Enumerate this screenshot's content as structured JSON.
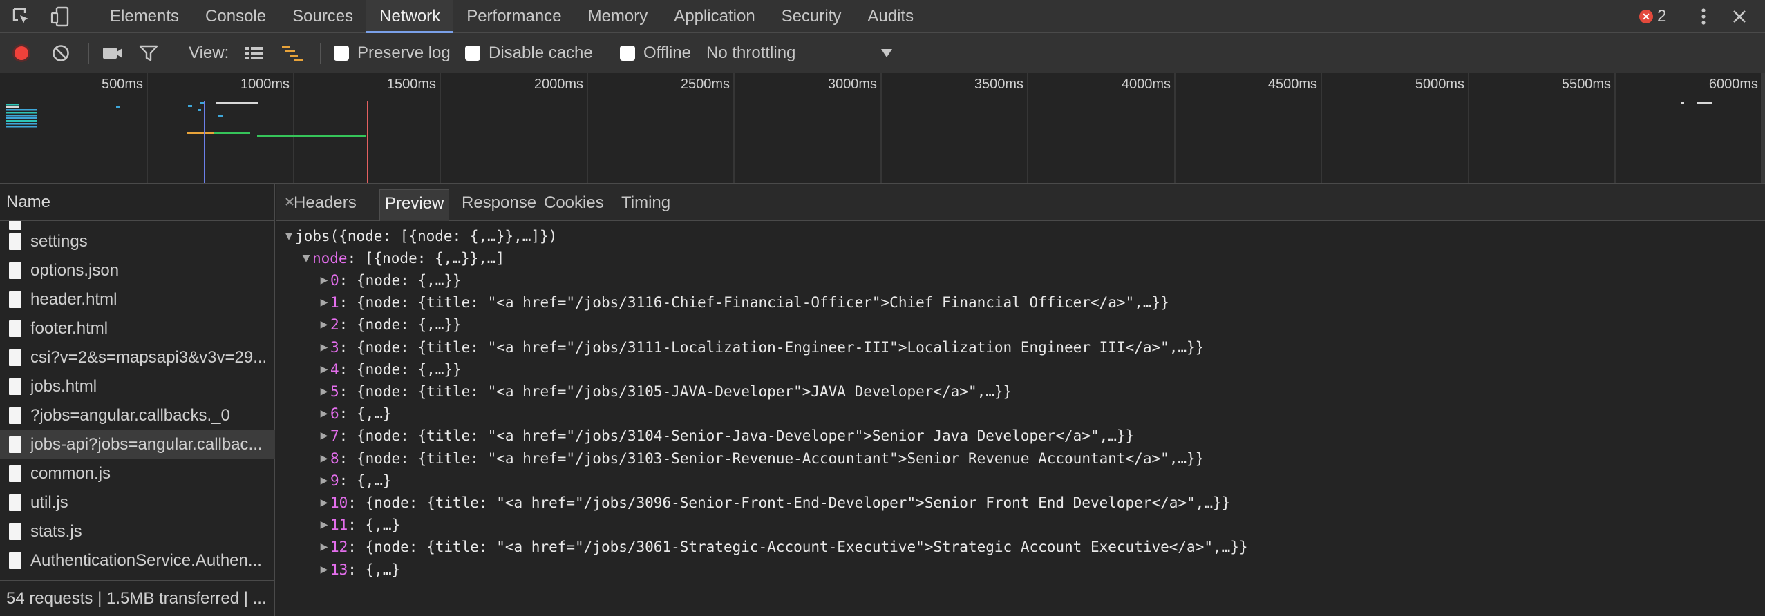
{
  "devtools": {
    "inspect_icon": "inspect-element-icon",
    "device_icon": "device-toolbar-icon",
    "tabs": [
      {
        "label": "Elements"
      },
      {
        "label": "Console"
      },
      {
        "label": "Sources"
      },
      {
        "label": "Network",
        "active": true
      },
      {
        "label": "Performance"
      },
      {
        "label": "Memory"
      },
      {
        "label": "Application"
      },
      {
        "label": "Security"
      },
      {
        "label": "Audits"
      }
    ],
    "error_count": "2",
    "accent_color": "#7aa0e8",
    "error_color": "#e34a3c"
  },
  "toolbar": {
    "view_label": "View:",
    "preserve_log": "Preserve log",
    "disable_cache": "Disable cache",
    "offline": "Offline",
    "throttling": "No throttling"
  },
  "overview": {
    "ticks": [
      "500ms",
      "1000ms",
      "1500ms",
      "2000ms",
      "2500ms",
      "3000ms",
      "3500ms",
      "4000ms",
      "4500ms",
      "5000ms",
      "5500ms",
      "6000ms"
    ]
  },
  "requests": {
    "header": "Name",
    "items": [
      {
        "label": "settings"
      },
      {
        "label": "options.json"
      },
      {
        "label": "header.html"
      },
      {
        "label": "footer.html"
      },
      {
        "label": "csi?v=2&s=mapsapi3&v3v=29..."
      },
      {
        "label": "jobs.html"
      },
      {
        "label": "?jobs=angular.callbacks._0"
      },
      {
        "label": "jobs-api?jobs=angular.callbac...",
        "selected": true
      },
      {
        "label": "common.js"
      },
      {
        "label": "util.js"
      },
      {
        "label": "stats.js"
      },
      {
        "label": "AuthenticationService.Authen..."
      }
    ],
    "summary": "54 requests | 1.5MB transferred | ..."
  },
  "detail_tabs": [
    {
      "label": "Headers"
    },
    {
      "label": "Preview",
      "active": true
    },
    {
      "label": "Response"
    },
    {
      "label": "Cookies"
    },
    {
      "label": "Timing"
    }
  ],
  "preview": {
    "root": "jobs({node: [{node: {,…}},…]})",
    "node_key": "node",
    "node_value": ": [{node: {,…}},…]",
    "items": [
      {
        "key": "0",
        "value": ": {node: {,…}}"
      },
      {
        "key": "1",
        "value": ": {node: {title: \"<a href=\"/jobs/3116-Chief-Financial-Officer\">Chief Financial Officer</a>\",…}}"
      },
      {
        "key": "2",
        "value": ": {node: {,…}}"
      },
      {
        "key": "3",
        "value": ": {node: {title: \"<a href=\"/jobs/3111-Localization-Engineer-III\">Localization Engineer III</a>\",…}}"
      },
      {
        "key": "4",
        "value": ": {node: {,…}}"
      },
      {
        "key": "5",
        "value": ": {node: {title: \"<a href=\"/jobs/3105-JAVA-Developer\">JAVA Developer</a>\",…}}"
      },
      {
        "key": "6",
        "value": ": {,…}"
      },
      {
        "key": "7",
        "value": ": {node: {title: \"<a href=\"/jobs/3104-Senior-Java-Developer\">Senior Java Developer</a>\",…}}"
      },
      {
        "key": "8",
        "value": ": {node: {title: \"<a href=\"/jobs/3103-Senior-Revenue-Accountant\">Senior Revenue Accountant</a>\",…}}"
      },
      {
        "key": "9",
        "value": ": {,…}"
      },
      {
        "key": "10",
        "value": ": {node: {title: \"<a href=\"/jobs/3096-Senior-Front-End-Developer\">Senior Front End Developer</a>\",…}}"
      },
      {
        "key": "11",
        "value": ": {,…}"
      },
      {
        "key": "12",
        "value": ": {node: {title: \"<a href=\"/jobs/3061-Strategic-Account-Executive\">Strategic Account Executive</a>\",…}}"
      },
      {
        "key": "13",
        "value": ": {,…}"
      }
    ]
  }
}
